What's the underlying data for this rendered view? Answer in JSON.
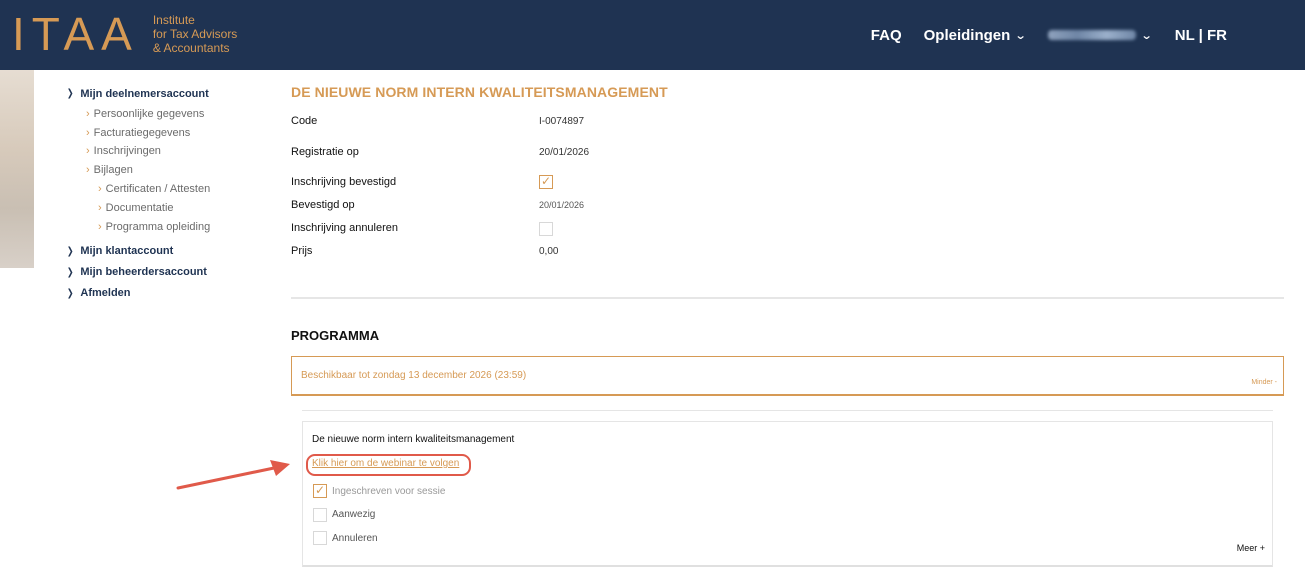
{
  "header": {
    "logo_mark": "ITAA",
    "logo_line1": "Institute",
    "logo_line2": "for Tax Advisors",
    "logo_line3": "& Accountants",
    "nav_faq": "FAQ",
    "nav_courses": "Opleidingen",
    "lang": "NL | FR"
  },
  "sidebar": {
    "participant_account": "Mijn deelnemersaccount",
    "sub_items": [
      "Persoonlijke gegevens",
      "Facturatiegegevens",
      "Inschrijvingen",
      "Bijlagen"
    ],
    "attachment_items": [
      "Certificaten / Attesten",
      "Documentatie",
      "Programma opleiding"
    ],
    "client_account": "Mijn klantaccount",
    "admin_account": "Mijn beheerdersaccount",
    "logout": "Afmelden"
  },
  "registration": {
    "title": "DE NIEUWE NORM INTERN KWALITEITSMANAGEMENT",
    "code_label": "Code",
    "code_value": "I-0074897",
    "registered_on_label": "Registratie op",
    "registered_on_value": "20/01/2026",
    "confirmed_label": "Inschrijving bevestigd",
    "confirmed_checked": true,
    "confirmed_on_label": "Bevestigd op",
    "confirmed_on_value": "20/01/2026",
    "cancel_label": "Inschrijving annuleren",
    "cancel_checked": false,
    "price_label": "Prijs",
    "price_value": "0,00"
  },
  "program": {
    "heading": "PROGRAMMA",
    "availability": "Beschikbaar tot zondag 13 december 2026 (23:59)",
    "toggle_less": "Minder -",
    "session_title": "De nieuwe norm intern kwaliteitsmanagement",
    "webinar_link": "Klik hier om de webinar te volgen",
    "options": [
      {
        "label": "Ingeschreven voor sessie",
        "checked": true
      },
      {
        "label": "Aanwezig",
        "checked": false
      },
      {
        "label": "Annuleren",
        "checked": false
      }
    ],
    "more": "Meer +"
  },
  "colors": {
    "brand_navy": "#1f3352",
    "accent_gold": "#d69a55",
    "annotation_red": "#e05a4a"
  }
}
